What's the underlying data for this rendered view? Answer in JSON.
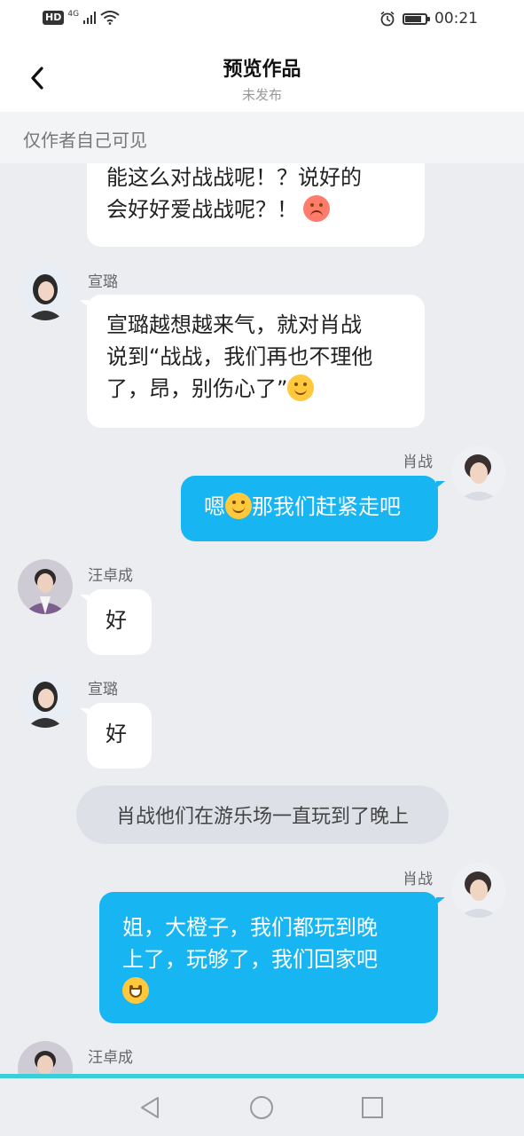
{
  "status_bar": {
    "network_badge": "HD",
    "network_type": "4G",
    "time": "00:21",
    "battery_level": 0.85
  },
  "header": {
    "title": "预览作品",
    "subtitle": "未发布"
  },
  "notice": "仅作者自己可见",
  "messages": {
    "m0": {
      "line1": "能这么对战战呢！？说好的",
      "line2": "会好好爱战战呢？！"
    },
    "m1": {
      "name": "宣璐",
      "line1": "宣璐越想越来气，就对肖战",
      "line2": "说到“战战，我们再也不理他",
      "line3": "了，昂，别伤心了”"
    },
    "m2": {
      "name": "肖战",
      "before": "嗯",
      "after": "那我们赶紧走吧"
    },
    "m3": {
      "name": "汪卓成",
      "text": "好"
    },
    "m4": {
      "name": "宣璐",
      "text": "好"
    },
    "m5": {
      "text": "肖战他们在游乐场一直玩到了晚上"
    },
    "m6": {
      "name": "肖战",
      "line1": "姐，大橙子，我们都玩到晚",
      "line2": "上了，玩够了，我们回家吧"
    },
    "m7": {
      "name": "汪卓成"
    }
  },
  "colors": {
    "right_bubble": "#17b5f2",
    "left_bubble": "#ffffff",
    "background": "#ebedf1",
    "accent_line": "#3dcdd7"
  },
  "icons": [
    "back-icon",
    "alarm-icon",
    "battery-icon",
    "signal-icon",
    "wifi-icon",
    "nav-back-icon",
    "nav-home-icon",
    "nav-recents-icon"
  ]
}
